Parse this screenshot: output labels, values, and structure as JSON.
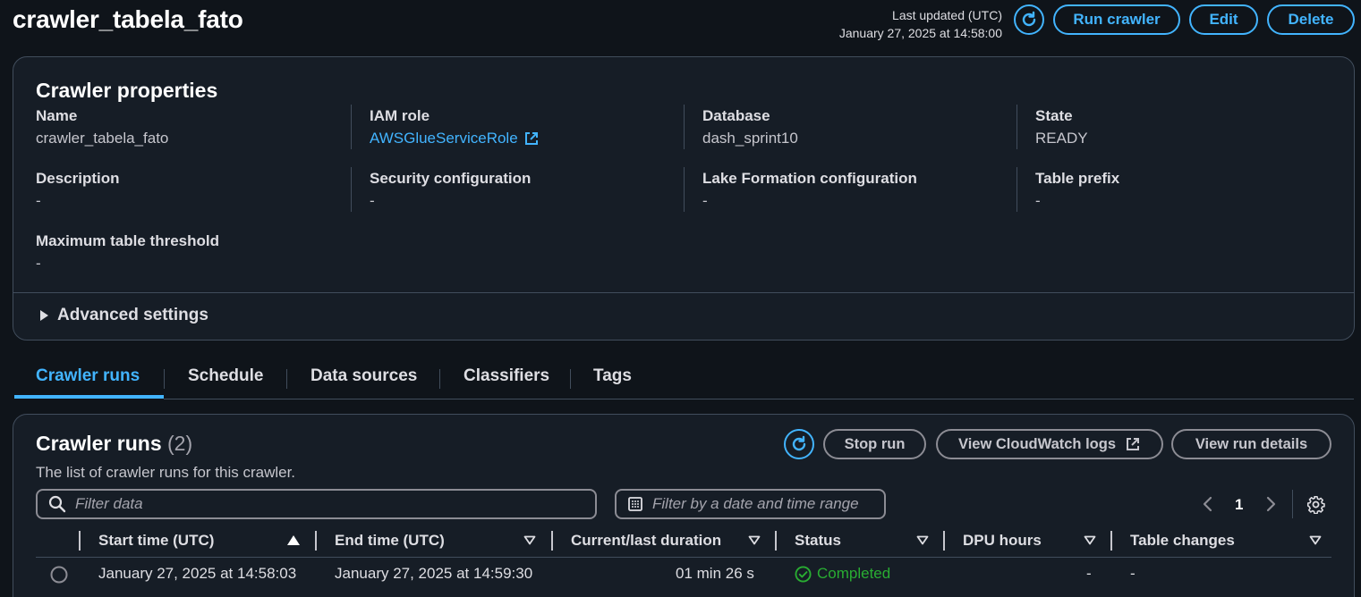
{
  "header": {
    "title": "crawler_tabela_fato",
    "last_updated_label": "Last updated (UTC)",
    "last_updated_value": "January 27, 2025 at 14:58:00",
    "run_label": "Run crawler",
    "edit_label": "Edit",
    "delete_label": "Delete"
  },
  "properties": {
    "title": "Crawler properties",
    "fields": [
      {
        "label": "Name",
        "value": "crawler_tabela_fato"
      },
      {
        "label": "IAM role",
        "value": "AWSGlueServiceRole"
      },
      {
        "label": "Database",
        "value": "dash_sprint10"
      },
      {
        "label": "State",
        "value": "READY"
      },
      {
        "label": "Description",
        "value": "-"
      },
      {
        "label": "Security configuration",
        "value": "-"
      },
      {
        "label": "Lake Formation configuration",
        "value": "-"
      },
      {
        "label": "Table prefix",
        "value": "-"
      },
      {
        "label": "Maximum table threshold",
        "value": "-"
      }
    ],
    "advanced_label": "Advanced settings"
  },
  "tabs": [
    "Crawler runs",
    "Schedule",
    "Data sources",
    "Classifiers",
    "Tags"
  ],
  "runs": {
    "title": "Crawler runs",
    "count": "(2)",
    "description": "The list of crawler runs for this crawler.",
    "stop_label": "Stop run",
    "cloudwatch_label": "View CloudWatch logs",
    "details_label": "View run details",
    "filter_placeholder": "Filter data",
    "date_filter_placeholder": "Filter by a date and time range",
    "page": "1",
    "columns": [
      "Start time (UTC)",
      "End time (UTC)",
      "Current/last duration",
      "Status",
      "DPU hours",
      "Table changes"
    ],
    "rows": [
      {
        "start": "January 27, 2025 at 14:58:03",
        "end": "January 27, 2025 at 14:59:30",
        "duration": "01 min 26 s",
        "status": "Completed",
        "dpu": "-",
        "changes": "-"
      }
    ]
  },
  "colors": {
    "accent": "#42b4ff",
    "success": "#29ad32",
    "background": "#0f141a",
    "panel": "#161d26"
  }
}
